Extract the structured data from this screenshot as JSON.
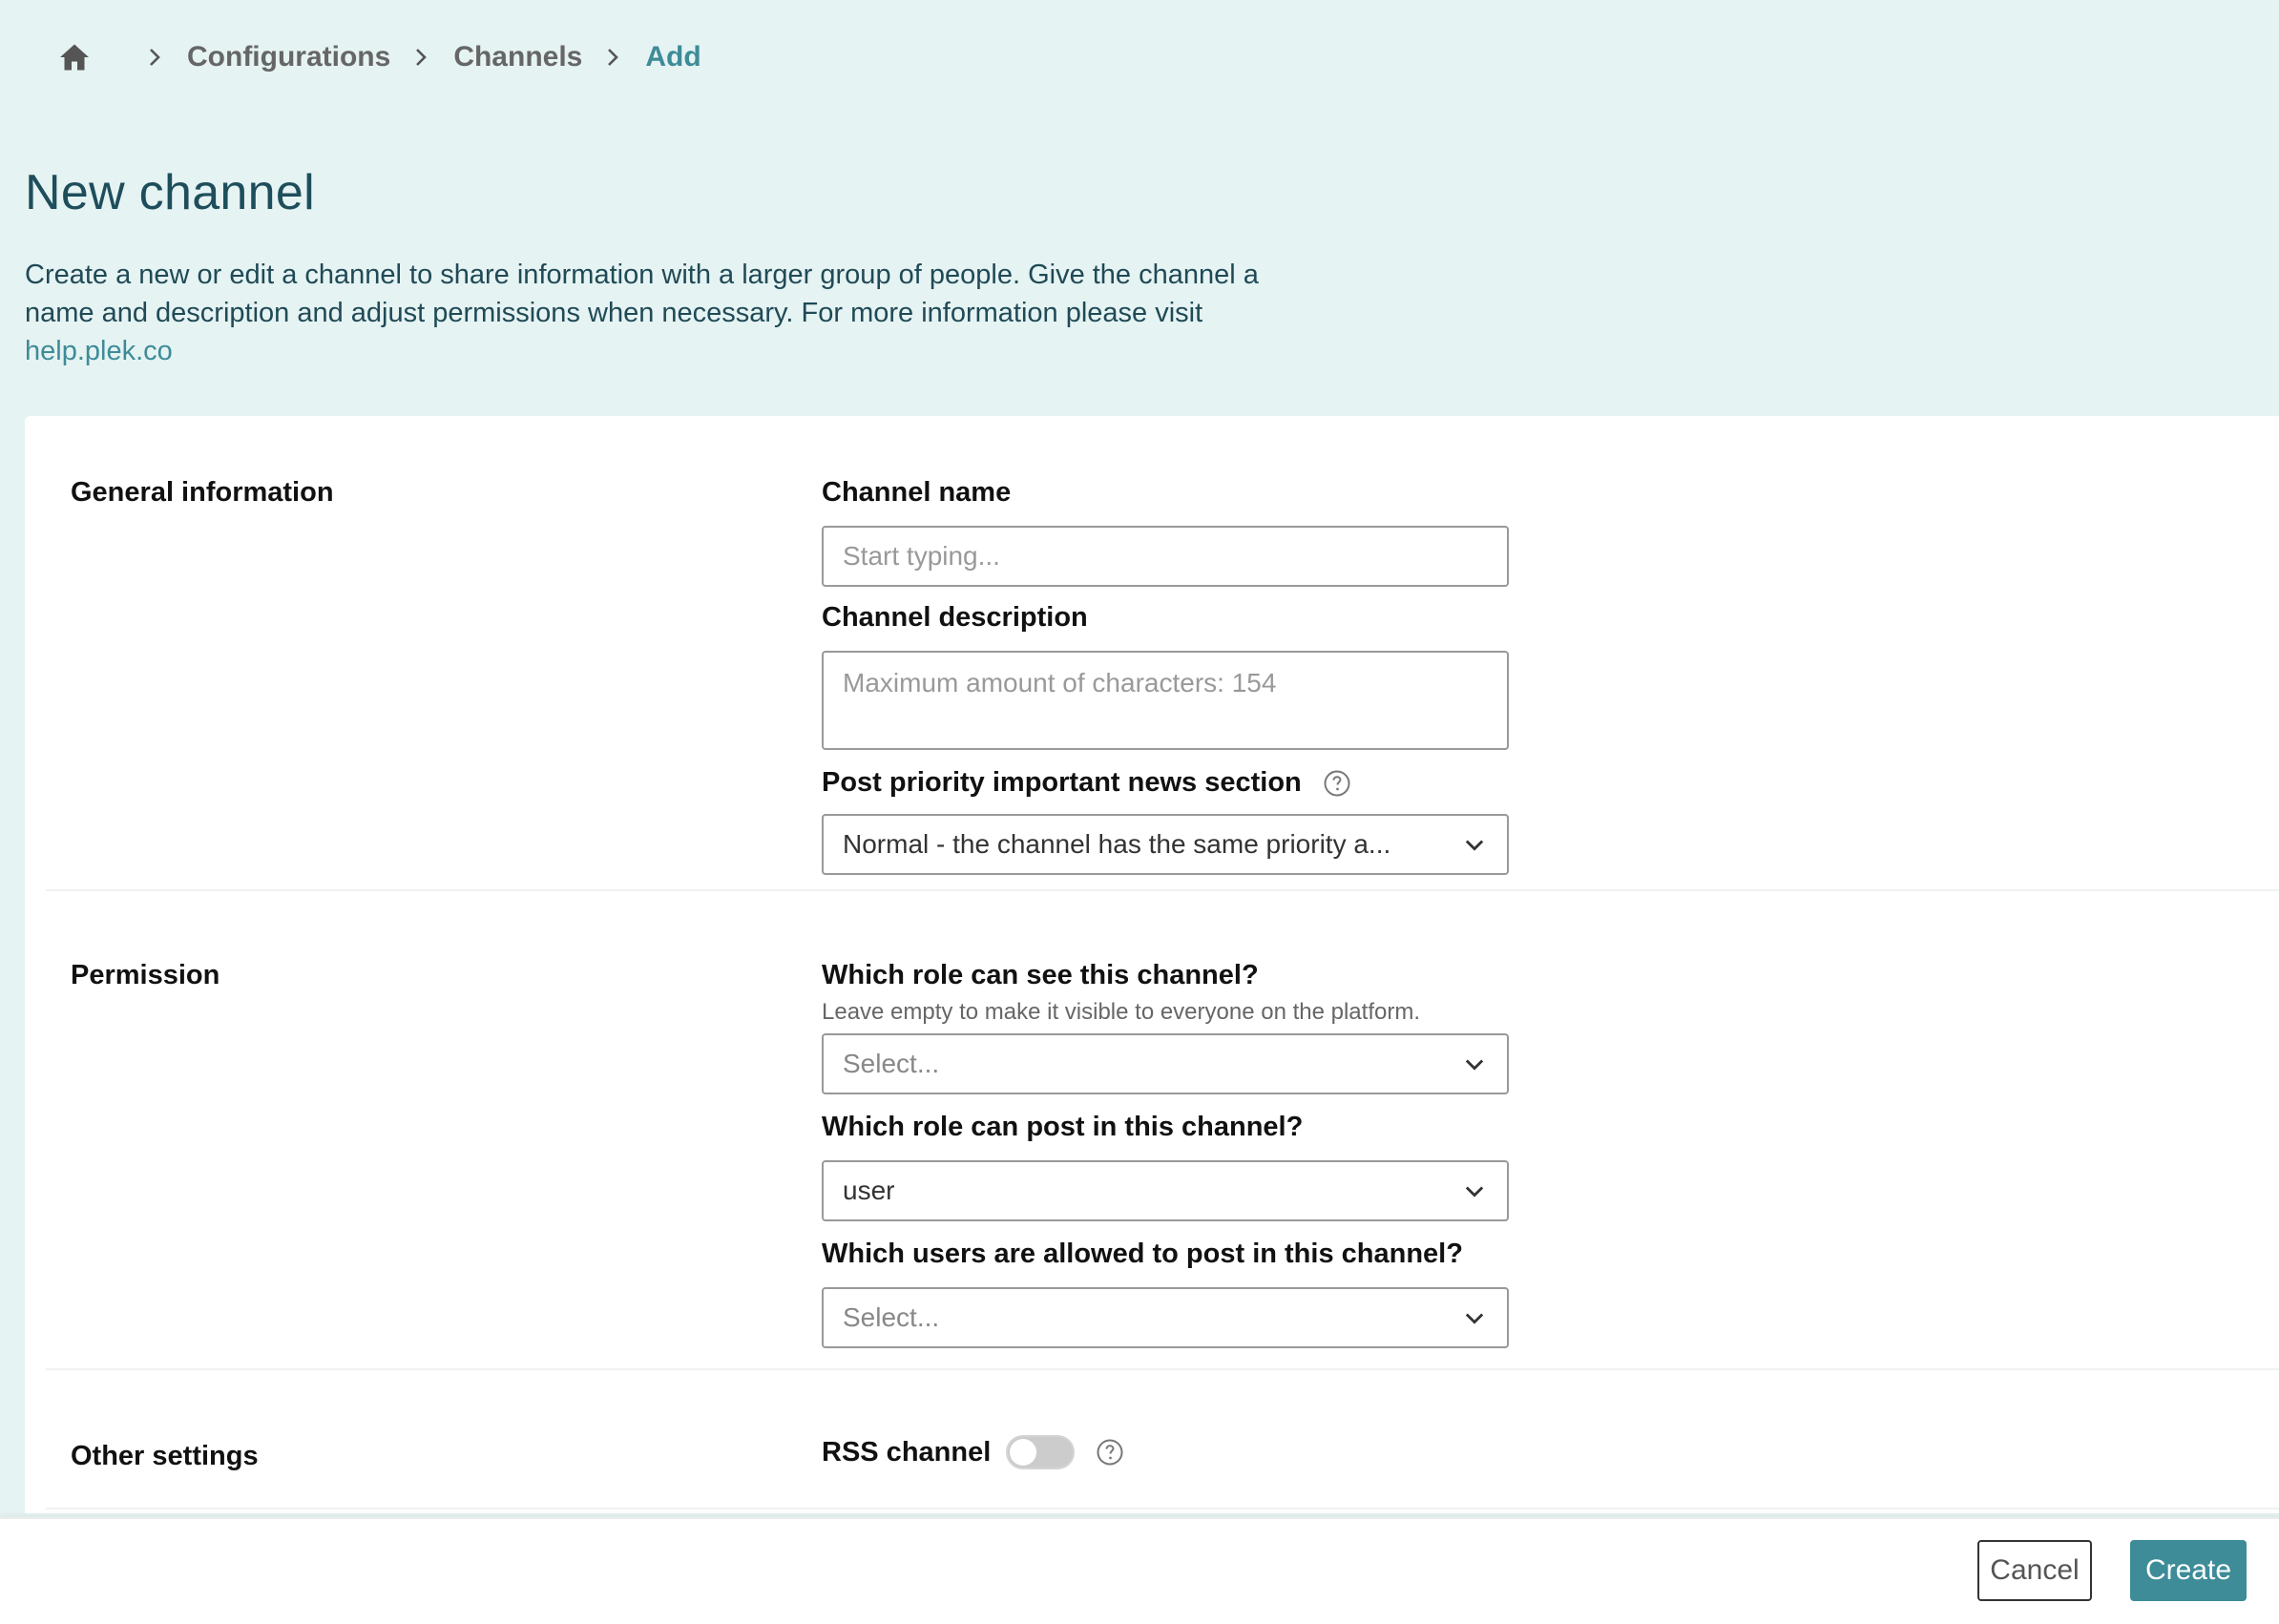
{
  "breadcrumb": {
    "home_icon": "home-icon",
    "items": [
      "Configurations",
      "Channels",
      "Add"
    ]
  },
  "page": {
    "title": "New channel",
    "intro_text": "Create a new or edit a channel to share information with a larger group of people. Give the channel a name and description and adjust permissions when necessary. For more information please visit ",
    "intro_link": "help.plek.co"
  },
  "general": {
    "section_label": "General information",
    "channel_name_label": "Channel name",
    "channel_name_placeholder": "Start typing...",
    "channel_description_label": "Channel description",
    "channel_description_placeholder": "Maximum amount of characters: 154",
    "priority_label": "Post priority important news section",
    "priority_value": "Normal - the channel has the same priority a..."
  },
  "permission": {
    "section_label": "Permission",
    "see_label": "Which role can see this channel?",
    "see_hint": "Leave empty to make it visible to everyone on the platform.",
    "see_placeholder": "Select...",
    "post_role_label": "Which role can post in this channel?",
    "post_role_value": "user",
    "post_users_label": "Which users are allowed to post in this channel?",
    "post_users_placeholder": "Select..."
  },
  "other": {
    "section_label": "Other settings",
    "rss_label": "RSS channel",
    "rss_enabled": false
  },
  "footer": {
    "cancel_label": "Cancel",
    "create_label": "Create"
  },
  "colors": {
    "accent": "#3d8c98",
    "page_bg": "#e6f3f3",
    "title": "#1e4e5c"
  }
}
